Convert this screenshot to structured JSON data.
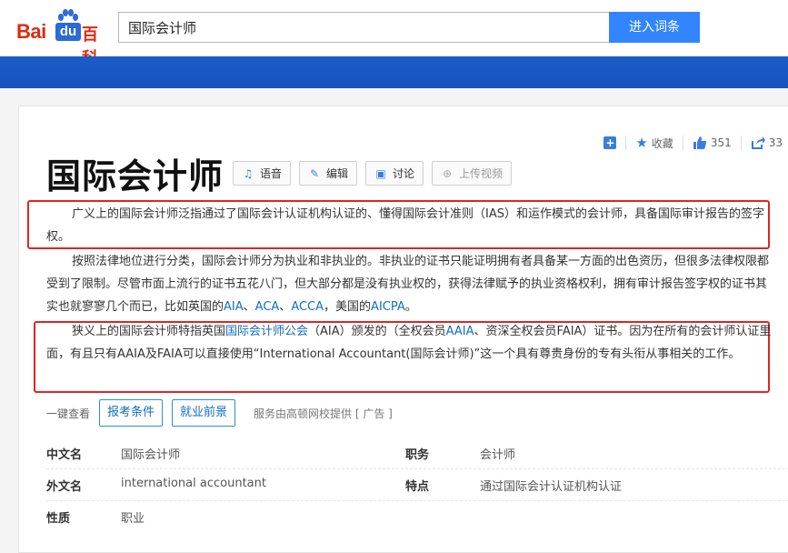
{
  "header": {
    "logo_bai": "Bai",
    "logo_du": "du",
    "logo_baike": "百科",
    "search_value": "国际会计师",
    "search_button": "进入词条"
  },
  "tools": {
    "favorite_label": "收藏",
    "like_count": "351",
    "share_count": "33"
  },
  "entry": {
    "title": "国际会计师",
    "actions": [
      {
        "label": "语音",
        "icon": "headphones-icon"
      },
      {
        "label": "编辑",
        "icon": "pencil-icon"
      },
      {
        "label": "讨论",
        "icon": "chat-icon"
      },
      {
        "label": "上传视频",
        "icon": "plus-circle-icon"
      }
    ]
  },
  "paragraphs": {
    "p1": "广义上的国际会计师泛指通过了国际会计认证机构认证的、懂得国际会计准则（IAS）和运作模式的会计师，具备国际审计报告的签字权。",
    "p2_text": "按照法律地位进行分类，国际会计师分为执业和非执业的。非执业的证书只能证明拥有者具备某一方面的出色资历，但很多法律权限都受到了限制。尽管市面上流行的证书五花八门，但大部分都是没有执业权的，获得法律赋予的执业资格权利，拥有审计报告签字权的证书其实也就寥寥几个而已，比如英国的",
    "p2_link1": "AIA",
    "p2_sep1": "、",
    "p2_link2": "ACA",
    "p2_sep2": "、",
    "p2_link3": "ACCA",
    "p2_sep3": "，美国的",
    "p2_link4": "AICPA",
    "p2_end": "。",
    "p3_a": "狭义上的国际会计师特指英国",
    "p3_link1": "国际会计师公会",
    "p3_b": "（AIA）颁发的（全权会员",
    "p3_link2": "AAIA",
    "p3_c": "、资深全权会员FAIA）证书。因为在所有的会计师认证里面，有且只有AAIA及FAIA可以直接使用“International Accountant(国际会计师)”这一个具有尊贵身份的专有头衔从事相关的工作。"
  },
  "onekey": {
    "label": "一键查看",
    "button1": "报考条件",
    "button2": "就业前景",
    "service": "服务由高顿网校提供 [ 广告 ]"
  },
  "infobox": {
    "rows": [
      {
        "l1": "中文名",
        "v1": "国际会计师",
        "l2": "职务",
        "v2": "会计师"
      },
      {
        "l1": "外文名",
        "v1": "international accountant",
        "l2": "特点",
        "v2": "通过国际会计认证机构认证"
      },
      {
        "l1": "性质",
        "v1": "职业",
        "l2": "",
        "v2": ""
      }
    ]
  },
  "colors": {
    "brand_red": "#de2910",
    "link_blue": "#136ec2",
    "search_blue": "#3385ff",
    "highlight_red": "#e02424"
  }
}
